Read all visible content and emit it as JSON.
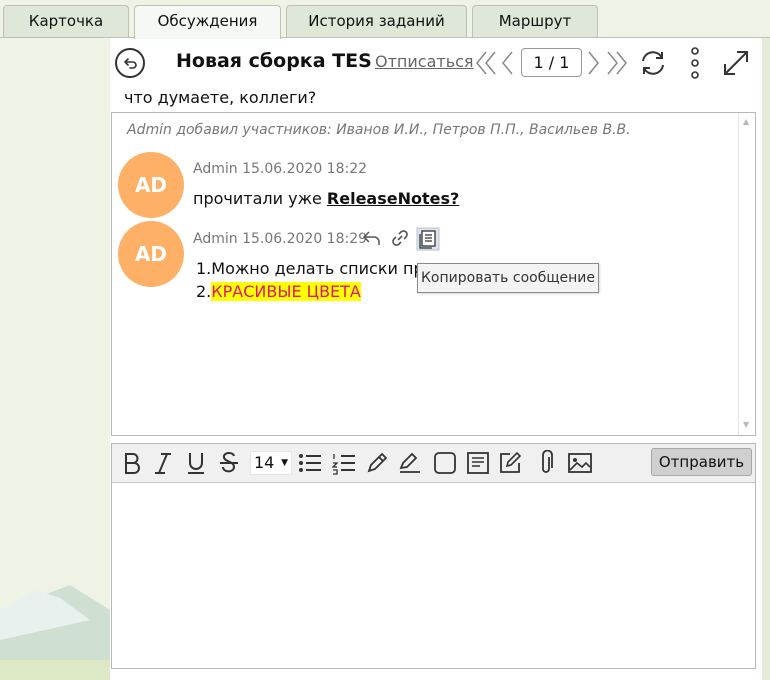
{
  "tabs": [
    {
      "label": "Карточка"
    },
    {
      "label": "Обсуждения"
    },
    {
      "label": "История заданий"
    },
    {
      "label": "Маршрут"
    }
  ],
  "active_tab": "Обсуждения",
  "header": {
    "title": "Новая сборка TESSA",
    "unsubscribe": "Отписаться",
    "page_indicator": "1 / 1"
  },
  "question": "что думаете, коллеги?",
  "chat": {
    "system_message": "Admin добавил участников: Иванов И.И., Петров П.П., Васильев В.В.",
    "messages": [
      {
        "avatar": "AD",
        "meta": "Admin 15.06.2020 18:22",
        "text_plain": "прочитали уже ",
        "text_bold": "ReleaseNotes?"
      },
      {
        "avatar": "AD",
        "meta": "Admin 15.06.2020 18:29",
        "line1": "1.Можно делать списки пря",
        "line2_prefix": "2.",
        "line2_colored": "КРАСИВЫЕ ЦВЕТА"
      }
    ],
    "tooltip": "Копировать сообщение"
  },
  "editor": {
    "font_size": "14",
    "send_label": "Отправить"
  },
  "icons": {
    "back": "back-arrow-icon",
    "refresh": "refresh-icon",
    "more": "more-vertical-icon",
    "expand": "expand-icon",
    "reply": "reply-icon",
    "link": "link-icon",
    "copy": "copy-message-icon"
  },
  "colors": {
    "avatar": "#ffb067",
    "highlight_bg": "#ffff00",
    "highlight_text": "#e0157a"
  }
}
